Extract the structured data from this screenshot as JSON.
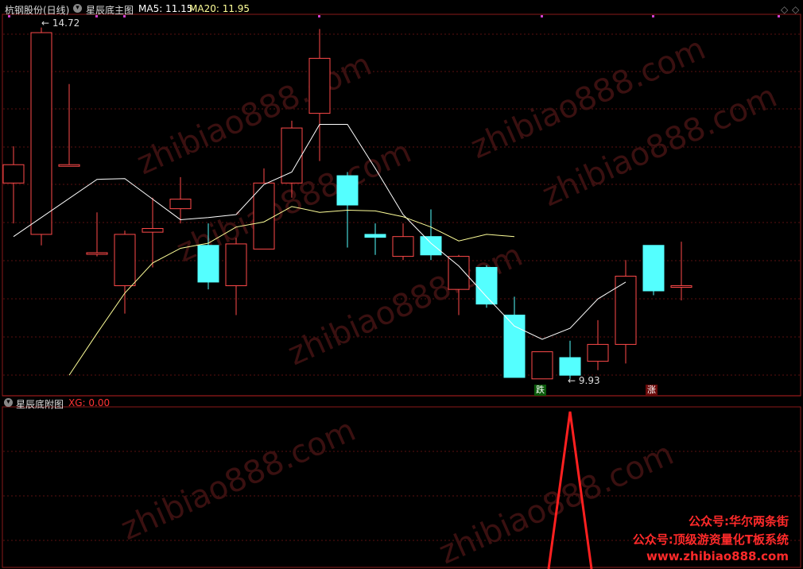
{
  "header": {
    "main_title": "杭钢股份(日线)",
    "indicator_name": "星辰底主图",
    "ma5_label": "MA5: 11.15",
    "ma20_label": "MA20: 11.95",
    "sub_title": "星辰底附图",
    "xg_label": "XG: 0.00"
  },
  "colors": {
    "up": "#ff4a4a",
    "down": "#54ffff",
    "ma5": "#ffffff",
    "ma20": "#ffff99",
    "grid": "#5a1010",
    "xg": "#ff2020"
  },
  "annotations": {
    "high_label": "14.72",
    "low_label": "9.93",
    "fall_signal": "跌",
    "rise_signal": "涨"
  },
  "watermarks": [
    "zhibiao888.com",
    "zhibiao888.com",
    "zhibiao888.com",
    "zhibiao888.com",
    "zhibiao888.com",
    "zhibiao888.com",
    "zhibiao888.com"
  ],
  "promo": {
    "line1": "公众号:华尔两条街",
    "line2": "公众号:顶级游资量化T板系统",
    "line3": "www.zhibiao888.com"
  },
  "chart_data": [
    {
      "type": "candlestick",
      "title": "星辰底主图",
      "ylim": [
        9.7,
        14.9
      ],
      "candles": [
        {
          "o": 12.6,
          "h": 13.1,
          "l": 12.05,
          "c": 12.85
        },
        {
          "o": 11.9,
          "h": 14.72,
          "l": 11.75,
          "c": 14.65
        },
        {
          "o": 12.85,
          "h": 13.95,
          "l": 12.85,
          "c": 12.85
        },
        {
          "o": 11.65,
          "h": 12.2,
          "l": 11.6,
          "c": 11.65
        },
        {
          "o": 11.2,
          "h": 11.95,
          "l": 10.82,
          "c": 11.9
        },
        {
          "o": 11.93,
          "h": 12.4,
          "l": 11.45,
          "c": 11.98
        },
        {
          "o": 12.25,
          "h": 12.68,
          "l": 12.05,
          "c": 12.38
        },
        {
          "o": 11.75,
          "h": 12.05,
          "l": 11.15,
          "c": 11.25
        },
        {
          "o": 11.2,
          "h": 11.85,
          "l": 10.8,
          "c": 11.77
        },
        {
          "o": 11.7,
          "h": 12.8,
          "l": 11.7,
          "c": 12.6
        },
        {
          "o": 12.6,
          "h": 13.45,
          "l": 12.4,
          "c": 13.35
        },
        {
          "o": 13.55,
          "h": 14.7,
          "l": 12.9,
          "c": 14.3
        },
        {
          "o": 12.7,
          "h": 12.75,
          "l": 11.72,
          "c": 12.3
        },
        {
          "o": 11.9,
          "h": 12.05,
          "l": 11.62,
          "c": 11.86
        },
        {
          "o": 11.6,
          "h": 12.05,
          "l": 11.55,
          "c": 11.87
        },
        {
          "o": 11.87,
          "h": 12.24,
          "l": 11.55,
          "c": 11.62
        },
        {
          "o": 11.15,
          "h": 11.62,
          "l": 10.8,
          "c": 11.6
        },
        {
          "o": 11.45,
          "h": 11.48,
          "l": 10.9,
          "c": 10.95
        },
        {
          "o": 10.8,
          "h": 11.05,
          "l": 9.95,
          "c": 9.95
        },
        {
          "o": 9.93,
          "h": 10.3,
          "l": 9.93,
          "c": 10.3
        },
        {
          "o": 10.22,
          "h": 10.45,
          "l": 9.93,
          "c": 9.98
        },
        {
          "o": 10.17,
          "h": 10.73,
          "l": 10.05,
          "c": 10.4
        },
        {
          "o": 10.4,
          "h": 11.55,
          "l": 10.14,
          "c": 11.33
        },
        {
          "o": 11.75,
          "h": 11.75,
          "l": 11.07,
          "c": 11.13
        },
        {
          "o": 11.2,
          "h": 11.8,
          "l": 11.0,
          "c": 11.2
        }
      ],
      "ma5": [
        11.87,
        null,
        null,
        12.65,
        12.66,
        12.38,
        12.1,
        12.13,
        12.17,
        12.58,
        12.75,
        13.4,
        13.4,
        12.8,
        12.17,
        11.78,
        11.47,
        11.05,
        10.65,
        10.47,
        10.62,
        11.02,
        11.25
      ],
      "ma5_start_index": 0,
      "ma20": [
        9.98,
        10.55,
        11.1,
        11.51,
        11.71,
        11.78,
        12.0,
        12.07,
        12.28,
        12.2,
        12.23,
        12.22,
        12.14,
        12.0,
        11.81,
        11.9,
        11.87
      ],
      "ma20_start_index": 2
    },
    {
      "type": "line",
      "title": "星辰底附图",
      "series": [
        {
          "name": "XG",
          "values": [
            0,
            0,
            0,
            0,
            0,
            0,
            0,
            0,
            0,
            0,
            0,
            0,
            0,
            0,
            0,
            0,
            0,
            0,
            0,
            0,
            1,
            0,
            0,
            0,
            0
          ]
        }
      ],
      "ylim": [
        0,
        1
      ]
    }
  ]
}
